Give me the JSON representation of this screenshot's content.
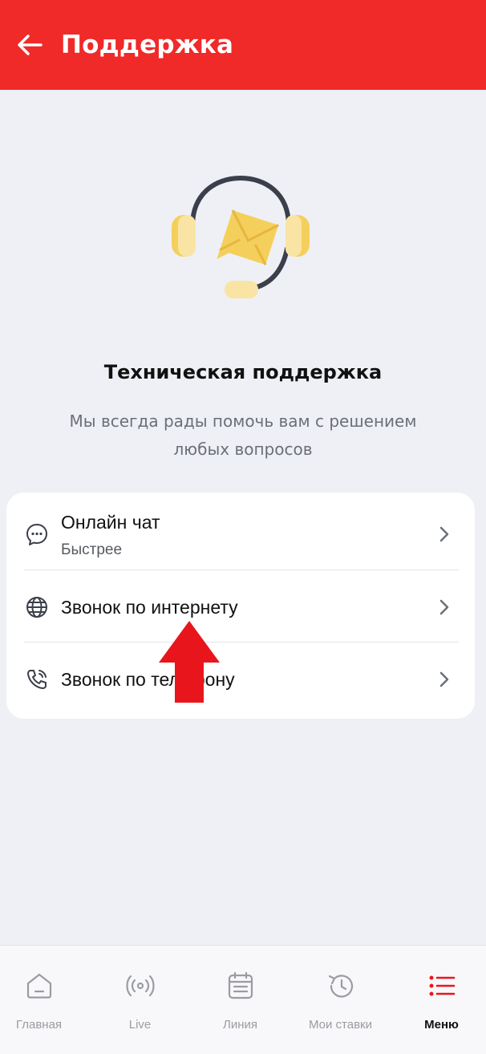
{
  "header": {
    "title": "Поддержка"
  },
  "support": {
    "title": "Техническая поддержка",
    "description": "Мы всегда рады помочь вам с решением любых вопросов"
  },
  "options": [
    {
      "label": "Онлайн чат",
      "sublabel": "Быстрее",
      "icon": "chat-bubble-icon"
    },
    {
      "label": "Звонок по интернету",
      "icon": "globe-icon"
    },
    {
      "label": "Звонок по телефону",
      "icon": "phone-icon"
    }
  ],
  "bottom_nav": [
    {
      "label": "Главная",
      "icon": "home-icon"
    },
    {
      "label": "Live",
      "icon": "live-broadcast-icon"
    },
    {
      "label": "Линия",
      "icon": "calendar-icon"
    },
    {
      "label": "Мои ставки",
      "icon": "history-icon"
    },
    {
      "label": "Меню",
      "icon": "menu-list-icon",
      "active": true
    }
  ],
  "colors": {
    "header": "#f02929",
    "accent_yellow": "#f5cf5b",
    "background": "#eef0f5",
    "annotation_arrow": "#e8161c"
  }
}
